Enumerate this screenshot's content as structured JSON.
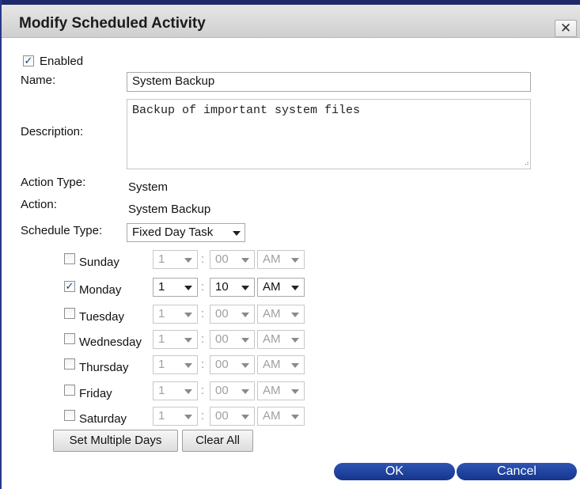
{
  "dialog": {
    "title": "Modify Scheduled Activity",
    "close_glyph": "✕"
  },
  "form": {
    "enabled_label": "Enabled",
    "enabled_checked": true,
    "name_label": "Name:",
    "name_value": "System Backup",
    "description_label": "Description:",
    "description_value": "Backup of important system files",
    "action_type_label": "Action Type:",
    "action_type_value": "System",
    "action_label": "Action:",
    "action_value": "System Backup",
    "schedule_type_label": "Schedule Type:",
    "schedule_type_value": "Fixed Day Task"
  },
  "days": [
    {
      "name": "Sunday",
      "checked": false,
      "hour": "1",
      "minute": "00",
      "ampm": "AM"
    },
    {
      "name": "Monday",
      "checked": true,
      "hour": "1",
      "minute": "10",
      "ampm": "AM"
    },
    {
      "name": "Tuesday",
      "checked": false,
      "hour": "1",
      "minute": "00",
      "ampm": "AM"
    },
    {
      "name": "Wednesday",
      "checked": false,
      "hour": "1",
      "minute": "00",
      "ampm": "AM"
    },
    {
      "name": "Thursday",
      "checked": false,
      "hour": "1",
      "minute": "00",
      "ampm": "AM"
    },
    {
      "name": "Friday",
      "checked": false,
      "hour": "1",
      "minute": "00",
      "ampm": "AM"
    },
    {
      "name": "Saturday",
      "checked": false,
      "hour": "1",
      "minute": "00",
      "ampm": "AM"
    }
  ],
  "time_separator": ":",
  "buttons": {
    "set_multiple": "Set Multiple Days",
    "clear_all": "Clear All",
    "ok": "OK",
    "cancel": "Cancel"
  },
  "icons": {
    "check_glyph": "✓",
    "resize_glyph": "⠴"
  }
}
